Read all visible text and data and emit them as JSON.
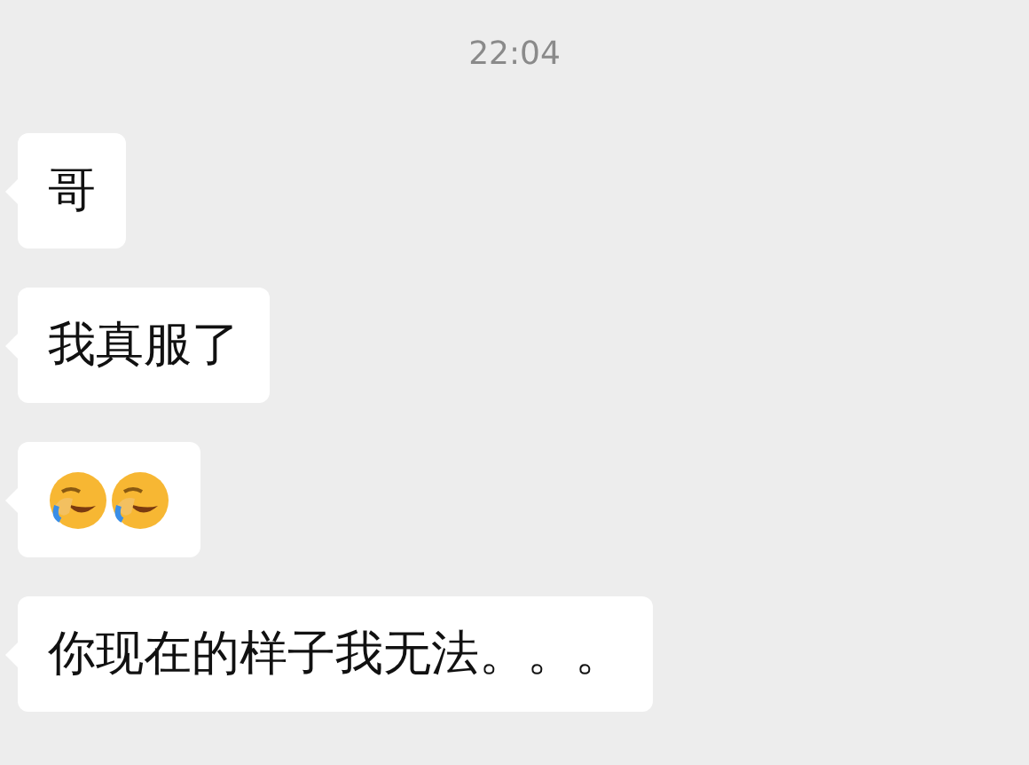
{
  "time": "22:04",
  "messages": [
    {
      "kind": "text",
      "text": "哥"
    },
    {
      "kind": "text",
      "text": "我真服了"
    },
    {
      "kind": "emoji",
      "items": [
        {
          "kind": "facepalm"
        },
        {
          "kind": "facepalm"
        }
      ]
    },
    {
      "kind": "text",
      "text": "你现在的样子我无法。。。"
    }
  ]
}
